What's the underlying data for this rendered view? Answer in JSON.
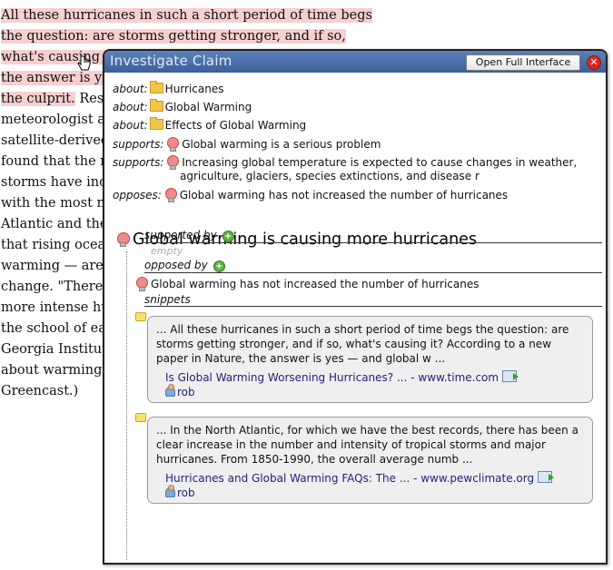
{
  "background_article": {
    "lines": [
      "All these hurricanes in such a short period of time begs",
      "the question: are storms getting stronger, and if so,",
      "what's causing it",
      "the answer is yes",
      "the culprit.",
      " Resea",
      "meteorologist at",
      "satellite-derived c",
      "found that the m",
      "storms have incr",
      "with the most no",
      "Atlantic and the",
      "that rising ocean",
      "warming — are c",
      "change. \"There is",
      "more intense hur",
      "the school of ear",
      "Georgia Institute",
      "about warming a",
      "Greencast.)"
    ]
  },
  "popup": {
    "title": "Investigate Claim",
    "open_button": "Open Full Interface",
    "close_icon": "✕",
    "about_label": "about:",
    "supports_label": "supports:",
    "opposes_label": "opposes:",
    "about": [
      "Hurricanes",
      "Global Warming",
      "Effects of Global Warming"
    ],
    "supports": [
      "Global warming is a serious problem",
      "Increasing global temperature is expected to cause changes in weather,",
      "agriculture, glaciers, species extinctions, and disease r"
    ],
    "opposes": [
      "Global warming has not increased the number of hurricanes"
    ],
    "claim": "Global warming is causing more hurricanes",
    "supported_by_label": "supported by",
    "empty_label": "empty",
    "opposed_by_label": "opposed by",
    "opposed_by_items": [
      "Global warming has not increased the number of hurricanes"
    ],
    "snippets_label": "snippets",
    "snippets": [
      {
        "text": "... All these hurricanes in such a short period of time begs the question: are storms getting stronger, and if so, what's causing it? According to a new paper in Nature, the answer is yes — and global w ...",
        "link": "Is Global Warming Worsening Hurricanes? ... - www.time.com",
        "user": "rob"
      },
      {
        "text": "... In the North Atlantic, for which we have the best records, there has been a clear increase in the number and intensity of tropical storms and major hurricanes. From 1850-1990, the overall average numb ...",
        "link": "Hurricanes and Global Warming FAQs: The ... - www.pewclimate.org",
        "user": "rob"
      }
    ]
  }
}
